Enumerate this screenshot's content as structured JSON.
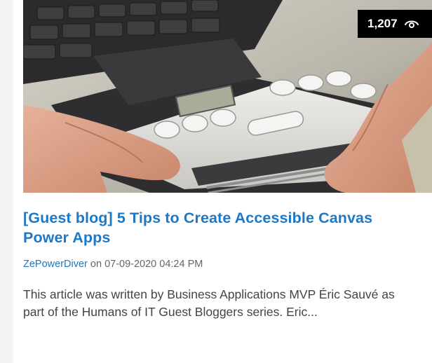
{
  "card": {
    "views": "1,207",
    "views_icon": "eye-icon",
    "title": "[Guest blog] 5 Tips to Create Accessible Canvas Power Apps",
    "author": "ZePowerDiver",
    "date_prefix": "on",
    "date": "07-09-2020 04:24 PM",
    "excerpt": "This article was written by Business Applications MVP Éric Sauvé as part of the Humans of IT Guest Bloggers series. Eric..."
  },
  "colors": {
    "link": "#1b79c8",
    "badge_bg": "#000000",
    "badge_text": "#ffffff"
  }
}
